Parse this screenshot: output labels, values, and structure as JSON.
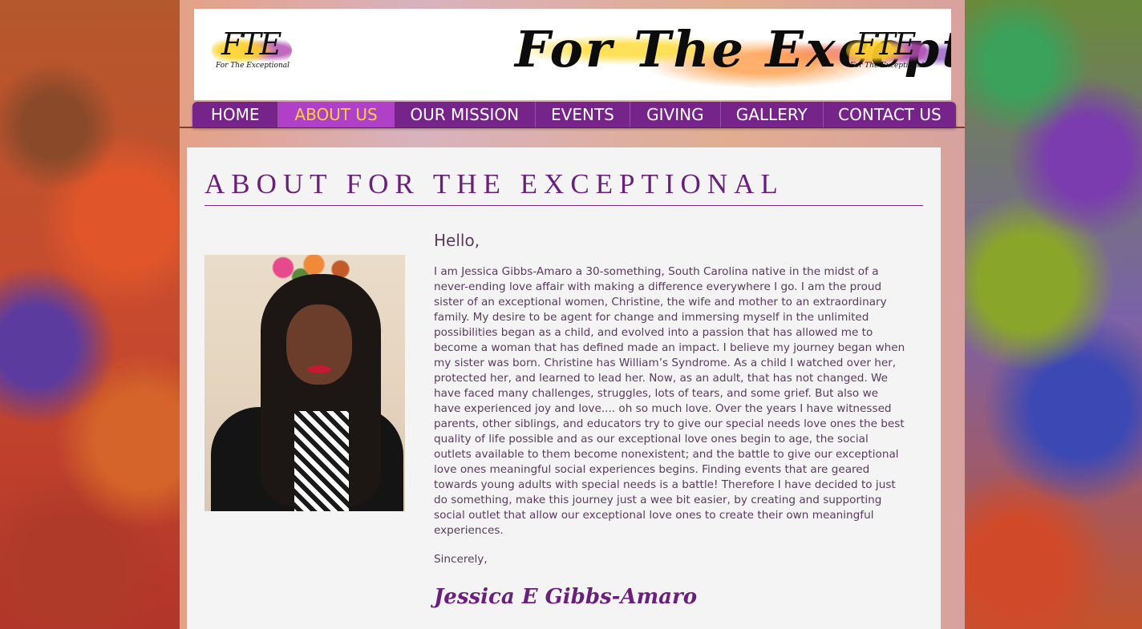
{
  "header": {
    "logo_mark": "FTE",
    "logo_subtitle": "For The Exceptional",
    "banner_title": "For The Exceptional"
  },
  "nav": {
    "items": [
      {
        "label": "HOME",
        "active": false
      },
      {
        "label": "ABOUT US",
        "active": true
      },
      {
        "label": "OUR MISSION",
        "active": false
      },
      {
        "label": "EVENTS",
        "active": false
      },
      {
        "label": "GIVING",
        "active": false
      },
      {
        "label": "GALLERY",
        "active": false
      },
      {
        "label": "CONTACT US",
        "active": false
      }
    ]
  },
  "about": {
    "title": "ABOUT  FOR THE EXCEPTIONAL",
    "greeting": "Hello,",
    "body": "I am Jessica Gibbs-Amaro a 30-something, South Carolina native in the midst of a never-ending love affair with making a difference everywhere I go.  I am the proud sister of an exceptional women, Christine, the wife and mother to an extraordinary family.  My desire to be agent for change and immersing myself in the unlimited possibilities began as a child, and evolved into a passion that has allowed me to become a woman that has defined made an impact.  I believe my journey began when my sister was born.  Christine has William’s Syndrome.  As a child I watched over her, protected her, and learned to lead her. Now, as an adult, that has not changed. We have faced many challenges, struggles, lots of tears, and some grief. But also we have experienced joy and love.... oh so much love.  Over the years I have witnessed parents, other siblings, and educators try to give our special needs love ones the best quality of life possible and as our exceptional love ones begin to age, the social outlets available to them become nonexistent; and the battle to give our exceptional love ones meaningful social experiences begins. Finding events that are geared towards young adults with special needs is a battle! Therefore I have decided to just do something, make this journey just a wee bit easier,  by creating and supporting social outlet that allow our exceptional love ones  to create their own meaningful experiences.",
    "closing": "Sincerely,",
    "signature": "Jessica E Gibbs-Amaro"
  },
  "colors": {
    "nav_bg": "#76248a",
    "nav_active_bg": "#b040c8",
    "nav_active_text": "#ffd23a",
    "title_color": "#6a1f7c",
    "body_text": "#5a3a5e"
  }
}
